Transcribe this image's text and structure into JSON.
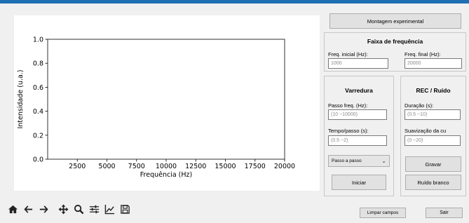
{
  "plot": {
    "chart_data": {
      "type": "line",
      "series": [],
      "xlabel": "Frequência (Hz)",
      "ylabel": "Intensidade (u.a.)",
      "xlim": [
        0,
        20000
      ],
      "ylim": [
        0.0,
        1.0
      ],
      "xticks": [
        "2500",
        "5000",
        "7500",
        "10000",
        "12500",
        "15000",
        "17500",
        "20000"
      ],
      "yticks": [
        "0.0",
        "0.2",
        "0.4",
        "0.6",
        "0.8",
        "1.0"
      ],
      "grid": false
    }
  },
  "toolbar": {
    "icons": [
      "home-icon",
      "back-arrow-icon",
      "forward-arrow-icon",
      "pan-icon",
      "zoom-icon",
      "configure-subplots-icon",
      "edit-axis-icon",
      "save-icon"
    ]
  },
  "panel": {
    "montagem_label": "Montagem experimental",
    "faixa": {
      "title": "Faixa de frequência",
      "freq_inicial_label": "Freq. inicial (Hz):",
      "freq_inicial_value": "1000",
      "freq_final_label": "Freq. final (Hz):",
      "freq_final_value": "20000"
    },
    "varredura": {
      "title": "Varredura",
      "passo_label": "Passo freq. (Hz):",
      "passo_placeholder": "(10 ~10000)",
      "tempo_label": "Tempo/passo (s):",
      "tempo_placeholder": "(0.5 ~2)",
      "mode_selected": "Passo a passo",
      "iniciar_label": "Iniciar"
    },
    "rec": {
      "title": "REC / Ruído",
      "duracao_label": "Duração (s):",
      "duracao_placeholder": "(0.5 ~10)",
      "suavizacao_label": "Suavização da cu",
      "suavizacao_placeholder": "(0 ~20)",
      "gravar_label": "Gravar",
      "ruido_label": "Ruído branco"
    },
    "limpar_label": "Limpar campos",
    "sair_label": "Sair"
  }
}
